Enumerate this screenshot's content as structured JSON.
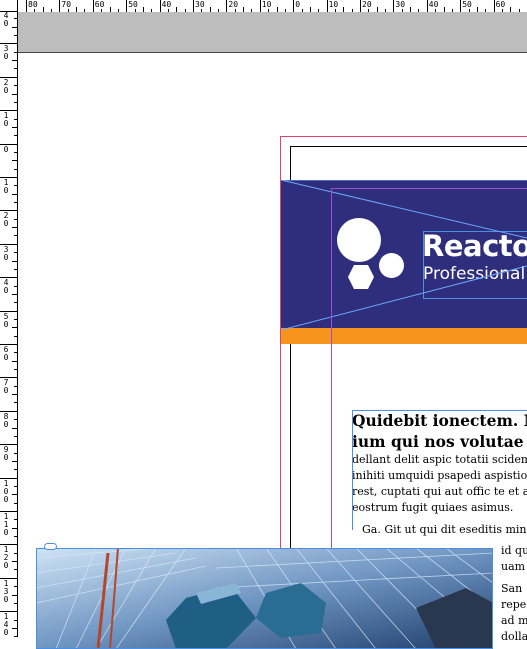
{
  "ruler": {
    "top_labels": [
      "80",
      "70",
      "60",
      "50",
      "40",
      "30",
      "20",
      "10",
      "0",
      "10",
      "20",
      "30",
      "40",
      "50",
      "60"
    ],
    "left_labels": [
      "40",
      "30",
      "20",
      "10",
      "0",
      "10",
      "20",
      "30",
      "40",
      "50",
      "60",
      "70",
      "80",
      "90",
      "100",
      "110",
      "120",
      "130",
      "140"
    ]
  },
  "banner": {
    "title": "Reacto",
    "subtitle": "Professional",
    "background_color": "#2f2e7c",
    "stripe_color": "#f7941d"
  },
  "article": {
    "heading_lines": [
      "Quidebit ionectem. Mai",
      "ium qui nos volutae ex e"
    ],
    "body_lines": [
      "dellant delit aspic totatii scidem",
      "inihiti umquidi psapedi aspistio",
      "rest, cuptati qui aut offic te et ac",
      "eostrum fugit quiaes asimus."
    ],
    "para2_first": "Ga. Git ut qui dit eseditis min",
    "col2_lines": [
      "id qu",
      "uam",
      "",
      "San",
      "repe",
      "ad m",
      "dolla"
    ]
  },
  "guides": {
    "margin_color": "#e0436b",
    "column_color": "#9b4fd6",
    "frame_color": "#4a90e2"
  }
}
